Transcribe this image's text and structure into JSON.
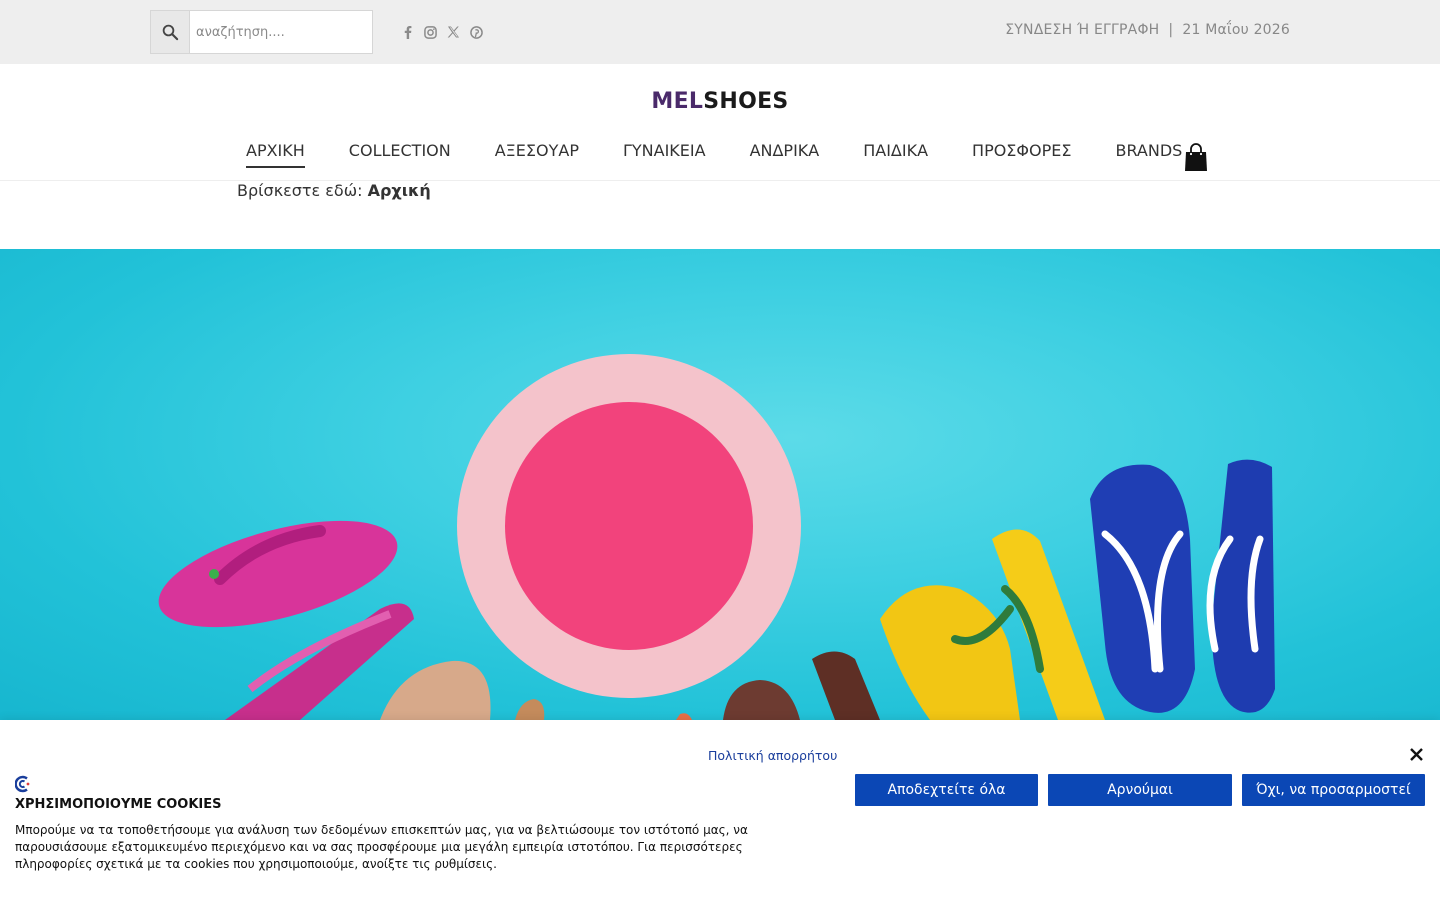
{
  "topbar": {
    "search_placeholder": "αναζήτηση....",
    "social_icons": [
      "facebook-icon",
      "instagram-icon",
      "x-icon",
      "pinterest-icon"
    ],
    "login_label": "ΣΥΝΔΕΣΗ Ή ΕΓΓΡΑΦΗ",
    "separator": "|",
    "date": "21 Μαΐου 2026"
  },
  "logo": {
    "part1": "MEL",
    "part2": "SHOES"
  },
  "nav": {
    "items": [
      {
        "label": "ΑΡΧΙΚΗ",
        "active": true
      },
      {
        "label": "COLLECTION"
      },
      {
        "label": "ΑΞΕΣΟΥΑΡ"
      },
      {
        "label": "ΓΥΝΑΙΚΕΙΑ"
      },
      {
        "label": "ΑΝΔΡΙΚΑ"
      },
      {
        "label": "ΠΑΙΔΙΚΑ"
      },
      {
        "label": "ΠΡΟΣΦΟΡΕΣ"
      },
      {
        "label": "BRANDS"
      }
    ]
  },
  "breadcrumb": {
    "prefix": "Βρίσκεστε εδώ:",
    "current": "Αρχική"
  },
  "cookie": {
    "policy_link": "Πολιτική απορρήτου",
    "title": "ΧΡΗΣΙΜΟΠΟΙΟΥΜΕ COOKIES",
    "text": "Μπορούμε να τα τοποθετήσουμε για ανάλυση των δεδομένων επισκεπτών μας, για να βελτιώσουμε τον ιστότοπό μας, να παρουσιάσουμε εξατομικευμένο περιεχόμενο και να σας προσφέρουμε μια μεγάλη εμπειρία ιστοτόπου. Για περισσότερες πληροφορίες σχετικά με τα cookies που χρησιμοποιούμε, ανοίξτε τις ρυθμίσεις.",
    "accept_all": "Αποδεχτείτε όλα",
    "reject": "Αρνούμαι",
    "customize": "Όχι, να προσαρμοστεί"
  },
  "colors": {
    "topbar_bg": "#eeeeee",
    "hero_bg": "#2ec8dc",
    "cookie_button": "#0b47b5",
    "logo_accent": "#4a2a6a"
  }
}
